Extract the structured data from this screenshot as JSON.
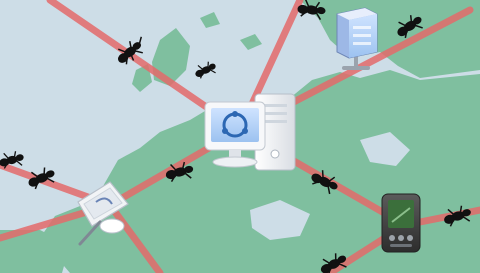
{
  "scene": {
    "background_color": "#ffffff",
    "sea_color": "#cddde7",
    "land_color": "#7fbf9f",
    "line_color": "#e36a6a",
    "bug_color": "#111111"
  },
  "devices": [
    {
      "name": "central-computer",
      "icon": "desktop-computer-icon"
    },
    {
      "name": "network-server",
      "icon": "server-icon"
    },
    {
      "name": "graphics-tablet",
      "icon": "tablet-icon"
    },
    {
      "name": "pda-device",
      "icon": "pda-icon"
    }
  ],
  "bugs_count": 10
}
